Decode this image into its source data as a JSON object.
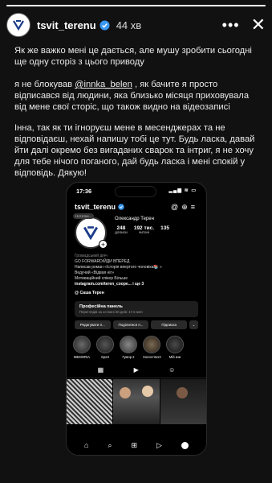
{
  "story": {
    "progress_fraction": 1.0,
    "username": "tsvit_terenu",
    "time_ago": "44 хв",
    "more_icon": "more-horizontal-icon",
    "close_icon": "close-icon"
  },
  "text": {
    "p1": "Як же важко мені це дається, але мушу зробити сьогодні ще одну сторіз з цього приводу",
    "p2_before": "я не блокував ",
    "p2_mention": "@innka_belen",
    "p2_after": " , як бачите я просто відписався від людини, яка близько місяця приховувала від мене свої сторіс, що також видно на відеозаписі",
    "p3": "Інна, так як ти ігноруєш мене в месенджерах та не відповідаєш, нехай напишу тобі це тут. Будь ласка, давай йти далі окремо без вигаданих сварок та інтриг, я не хочу для тебе нічого поганого, дай будь ласка і мені спокій у відповідь. Дякую!"
  },
  "phone": {
    "status_time": "17:36",
    "status_right": "▂▄▆ ≋ ▭",
    "profile": {
      "username": "tsvit_terenu",
      "note": "Нотатки...",
      "full_name": "Олександр Терен",
      "stats": [
        {
          "number": "248",
          "label": "дописи"
        },
        {
          "number": "192 тис.",
          "label": "читачі"
        },
        {
          "number": "135",
          "label": ""
        }
      ],
      "category": "Громадський діяч",
      "bio_lines": [
        "GO FORWARD/ЙДИ ВПЕРЕД",
        "Написав роман «Історія впертого чоловіка📚 »",
        "Ведучий «Відвая ніг»",
        "Мотиваційний спікер Більше"
      ],
      "link": "instagram.com/teren_coope... і ще 3",
      "threads": "@ Саша Терен"
    },
    "pro_panel": {
      "title": "Професійна панель",
      "subtitle": "Переглядів за останні 30 днів: 17,6 млн"
    },
    "buttons": [
      "Редагувати п...",
      "Поділитися п...",
      "Підписка",
      "⌄"
    ],
    "highlights": [
      "MEMORIA",
      "Sport",
      "Гумор 2",
      "Холостяк13",
      "Мій кни"
    ],
    "tab_icons": [
      "grid-icon",
      "reels-icon",
      "tagged-icon"
    ],
    "nav_icons": [
      "home-icon",
      "search-icon",
      "add-icon",
      "reels-icon",
      "profile-icon"
    ]
  }
}
